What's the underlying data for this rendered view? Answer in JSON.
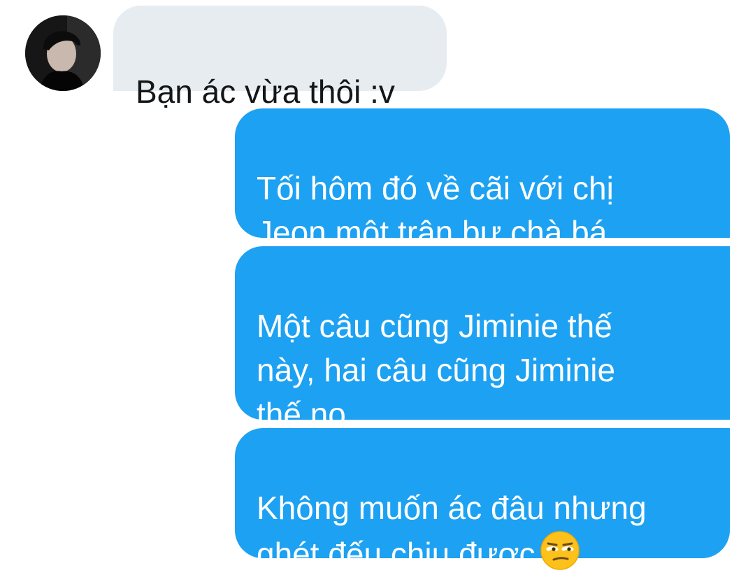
{
  "conversation": {
    "incoming": [
      {
        "text": "Bạn ác vừa thôi :v"
      }
    ],
    "outgoing": [
      {
        "text": "Tối hôm đó về cãi với chị\nJeon một trận bự chà bá"
      },
      {
        "text": "Một câu cũng Jiminie thế\nnày, hai câu cũng Jiminie\nthế nọ"
      },
      {
        "text": "Không muốn ác đâu nhưng\nghét đếu chịu được",
        "emoji": "unamused-face-emoji"
      }
    ]
  },
  "colors": {
    "incoming_bubble": "#e6ecf0",
    "outgoing_bubble": "#1da1f2",
    "incoming_text": "#14171a",
    "outgoing_text": "#ffffff"
  }
}
